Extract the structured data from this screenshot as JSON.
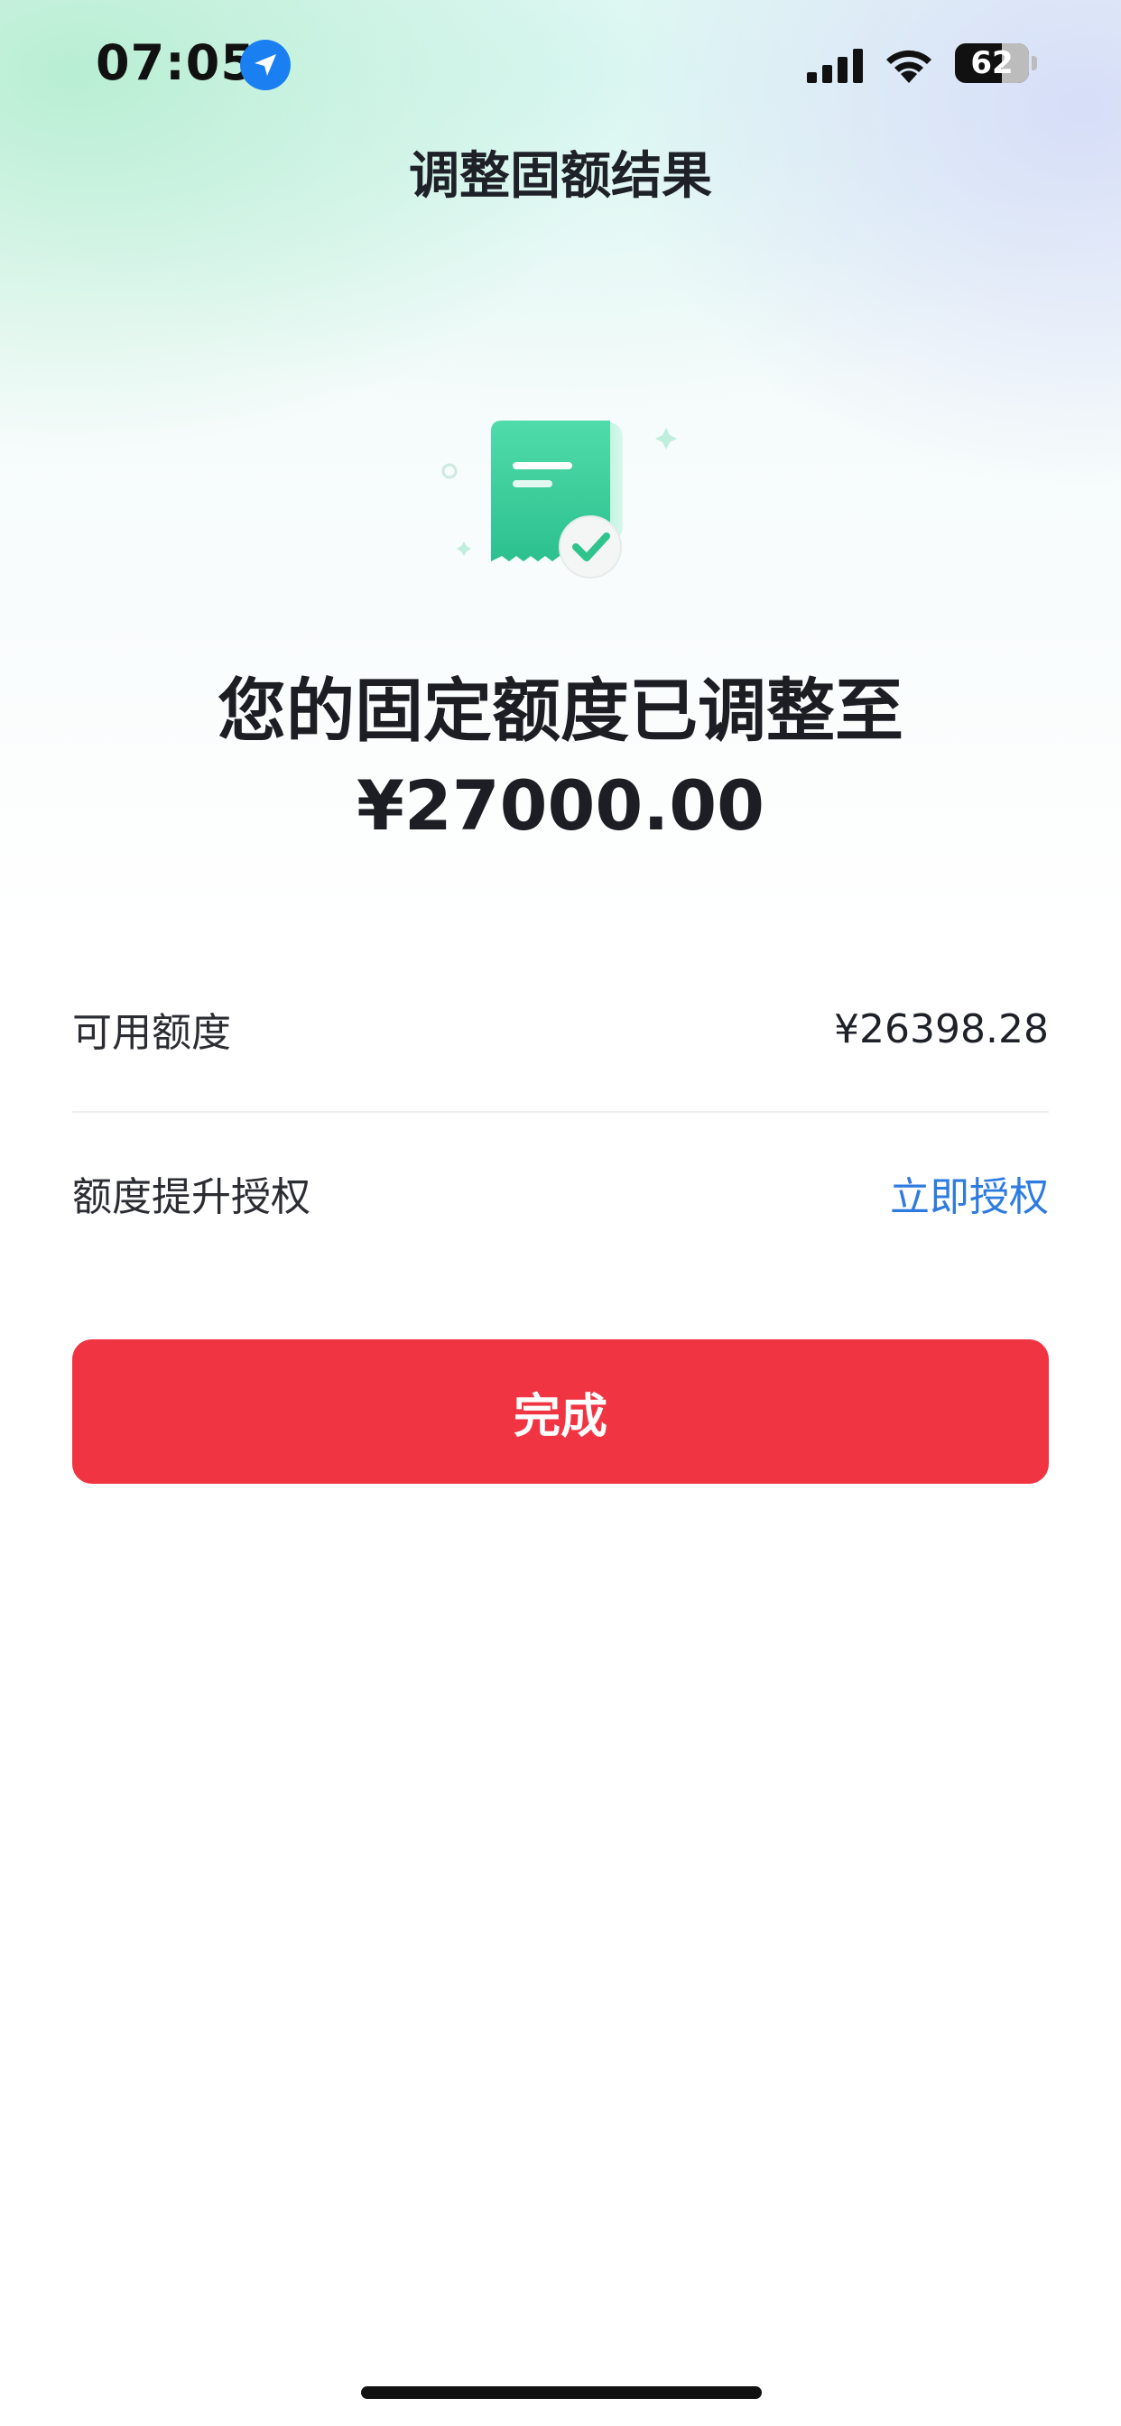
{
  "status_bar": {
    "time": "07:05",
    "battery": "62",
    "icons": [
      "location-icon",
      "signal-icon",
      "wifi-icon",
      "battery-icon"
    ]
  },
  "nav": {
    "title": "调整固额结果"
  },
  "result": {
    "illustration_icon": "receipt-check-icon",
    "headline": "您的固定额度已调整至",
    "amount": "¥27000.00"
  },
  "details": {
    "available_label": "可用额度",
    "available_value": "¥26398.28",
    "auth_label": "额度提升授权",
    "auth_link": "立即授权"
  },
  "actions": {
    "done_label": "完成"
  },
  "colors": {
    "primary_button": "#f03442",
    "link": "#2e7be0",
    "success_green": "#2fc48d"
  }
}
